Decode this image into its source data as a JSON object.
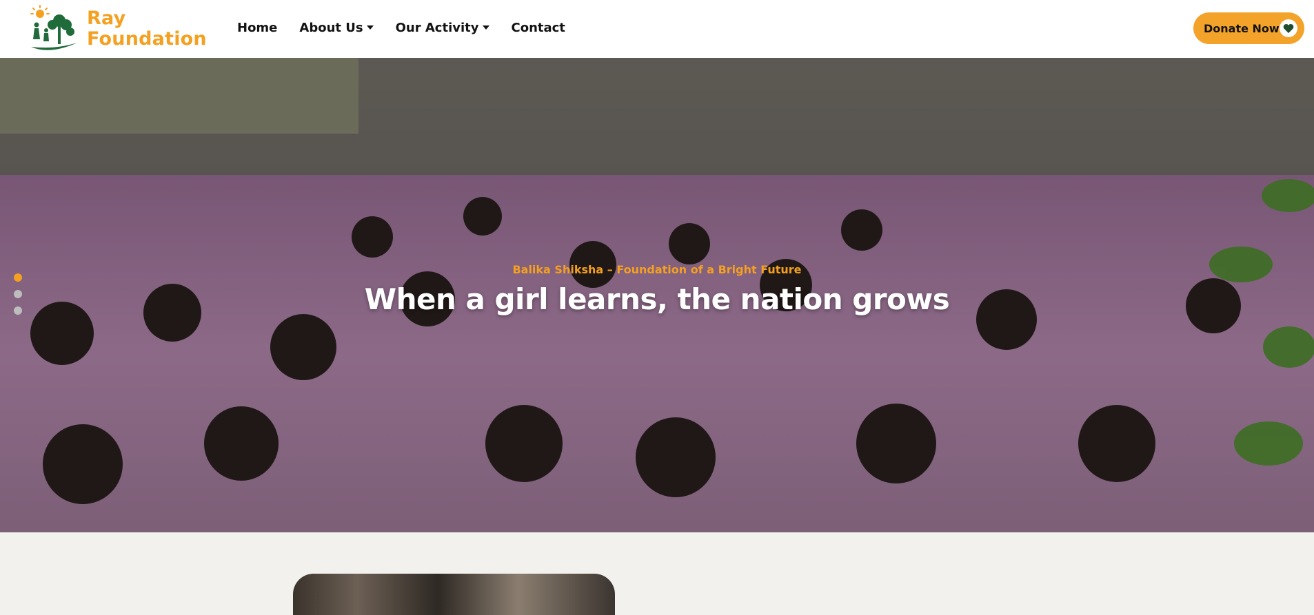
{
  "brand": {
    "line1": "Ray",
    "line2": "Foundation",
    "color": "#f4a020",
    "logo_icon": "tree-sun-logo-icon"
  },
  "nav": {
    "items": [
      {
        "label": "Home",
        "dropdown": false
      },
      {
        "label": "About Us",
        "dropdown": true
      },
      {
        "label": "Our Activity",
        "dropdown": true
      },
      {
        "label": "Contact",
        "dropdown": false
      }
    ]
  },
  "donate": {
    "label": "Donate Now",
    "icon": "heart-icon",
    "color": "#f4a32a"
  },
  "hero": {
    "subtitle": "Balika Shiksha – Foundation of a Bright Future",
    "title": "When a girl learns, the nation grows",
    "slides_total": 3,
    "active_slide": 1,
    "accent": "#f4a020"
  }
}
